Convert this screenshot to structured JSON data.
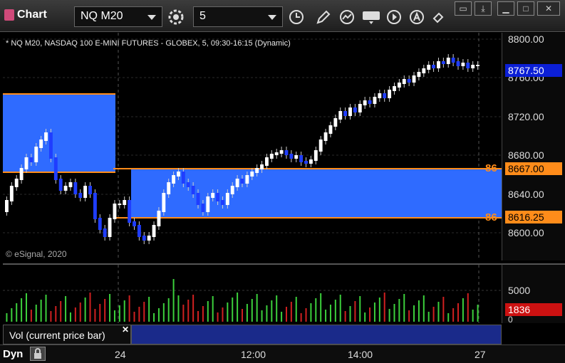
{
  "toolbar": {
    "app_title": "Chart",
    "symbol": "NQ M20",
    "interval": "5"
  },
  "chart": {
    "title": "* NQ M20, NASDAQ 100 E-MINI FUTURES - GLOBEX, 5, 09:30-16:15 (Dynamic)",
    "watermark": "© eSignal, 2020",
    "price_labels": [
      "8800.00",
      "8760.00",
      "8720.00",
      "8680.00",
      "8640.00",
      "8600.00"
    ],
    "current_price": "8767.50",
    "zone_upper_price": "8667.00",
    "zone_lower_price": "8616.25",
    "zone_upper_label": "86",
    "zone_lower_label": "86",
    "colors": {
      "zone": "#2f6bff",
      "zone_line": "#ff8c1a",
      "current_tag": "#0b1fd6",
      "vol_tag": "#cc1111"
    }
  },
  "volume": {
    "legend": "Vol (current price bar)",
    "labels": [
      "5000",
      "0"
    ],
    "current": "1836"
  },
  "time_axis": {
    "mode": "Dyn",
    "labels": [
      "24",
      "12:00",
      "14:00",
      "27"
    ]
  }
}
